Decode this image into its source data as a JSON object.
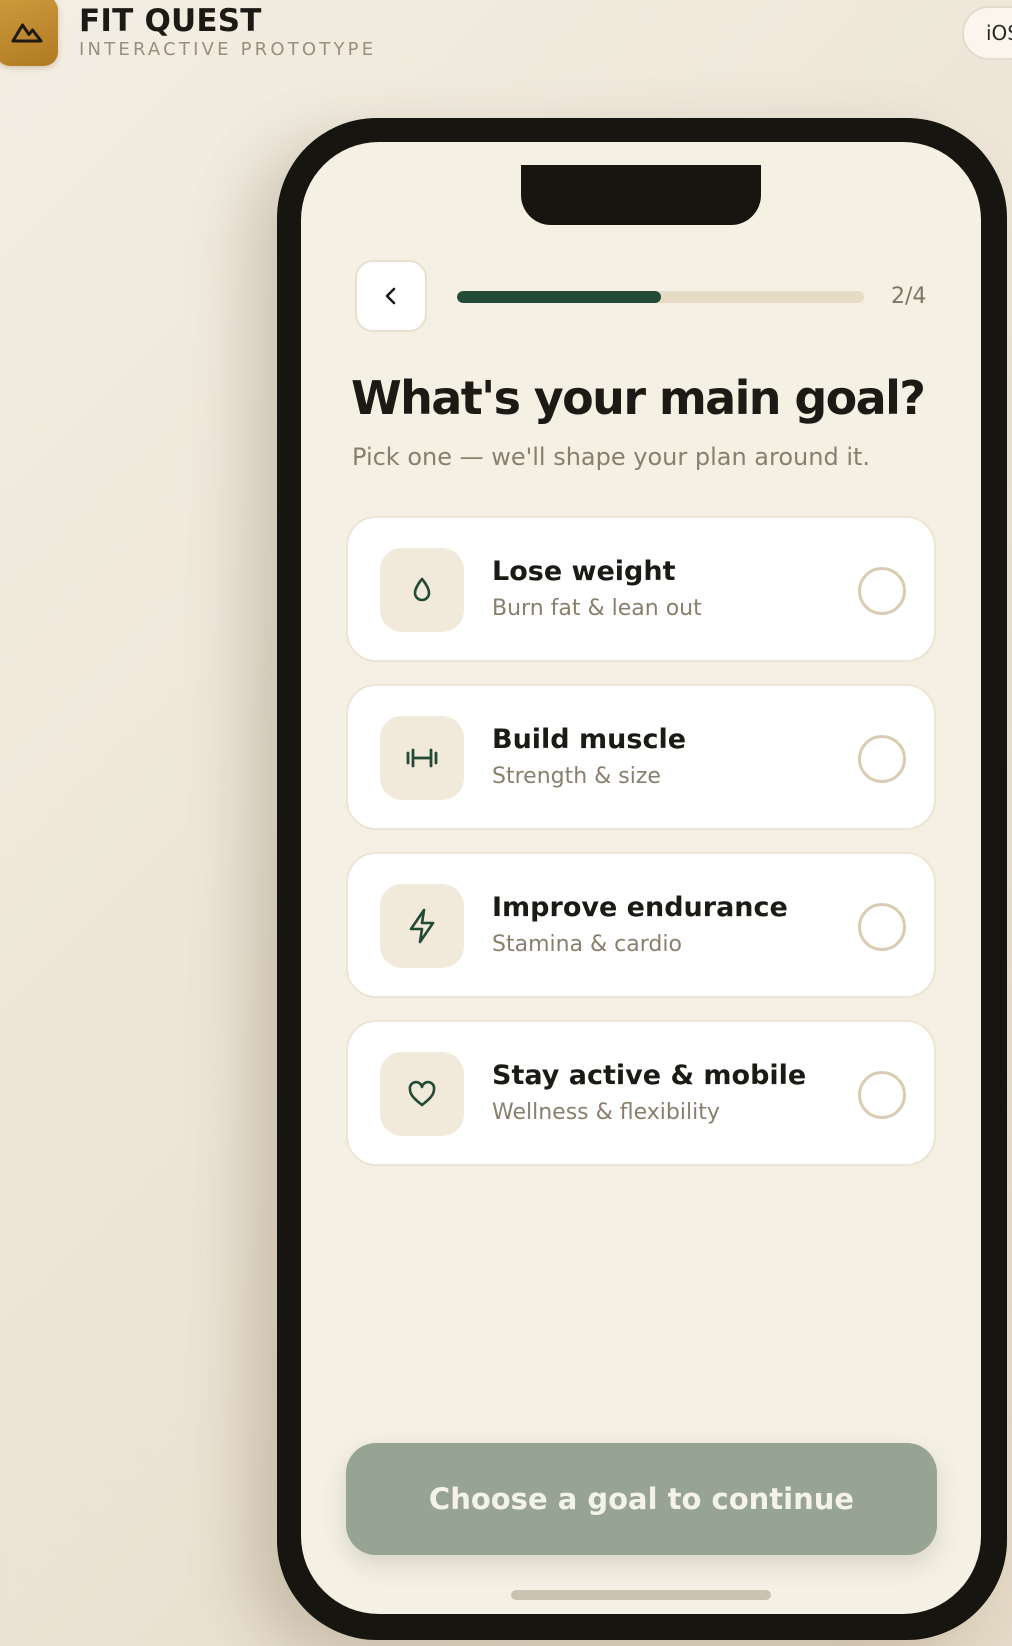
{
  "brand": {
    "title": "FIT QUEST",
    "subtitle": "INTERACTIVE PROTOTYPE",
    "logo_icon": "mountain-icon",
    "accent": "#b8842c"
  },
  "platform": {
    "label": "iOS"
  },
  "header": {
    "back_icon": "chevron-left-icon",
    "progress_fraction": 0.5,
    "step_counter": "2/4",
    "progress_color": "#234a36"
  },
  "question": {
    "title": "What's your main goal?",
    "subtitle": "Pick one — we'll shape your plan around it."
  },
  "goals": [
    {
      "title": "Lose weight",
      "description": "Burn fat & lean out",
      "icon": "droplet-icon",
      "selected": false
    },
    {
      "title": "Build muscle",
      "description": "Strength & size",
      "icon": "dumbbell-icon",
      "selected": false
    },
    {
      "title": "Improve endurance",
      "description": "Stamina & cardio",
      "icon": "lightning-bolt-icon",
      "selected": false
    },
    {
      "title": "Stay active & mobile",
      "description": "Wellness & flexibility",
      "icon": "heart-icon",
      "selected": false
    }
  ],
  "cta": {
    "label": "Choose a goal to continue",
    "enabled": false,
    "color": "#97a393"
  }
}
